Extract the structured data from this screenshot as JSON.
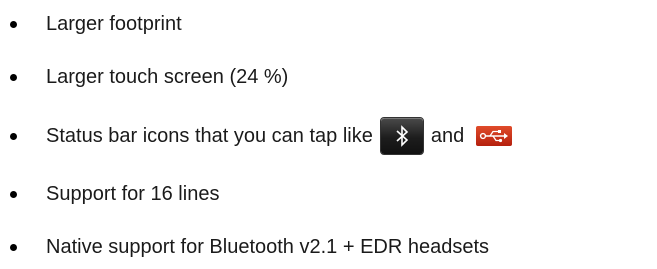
{
  "bullets": [
    {
      "text": "Larger footprint"
    },
    {
      "text": "Larger touch screen (24 %)"
    },
    {
      "text_before": "Status bar icons that you can tap like",
      "text_between": "and",
      "icons": [
        "bluetooth-icon",
        "usb-icon"
      ]
    },
    {
      "text": "Support for 16 lines"
    },
    {
      "text": "Native support for Bluetooth v2.1 + EDR headsets"
    }
  ],
  "colors": {
    "text": "#1a1a1a",
    "bullet": "#000000",
    "bluetooth_icon_bg": "#1d1d1d",
    "usb_icon_bg": "#c7321a"
  }
}
